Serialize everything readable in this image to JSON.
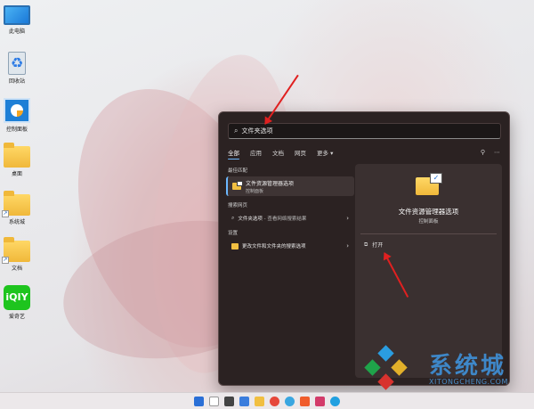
{
  "desktop": {
    "icons": [
      {
        "name": "此电脑",
        "glyph": "monitor-icon"
      },
      {
        "name": "回收站",
        "glyph": "recycle-bin-icon"
      },
      {
        "name": "控制面板",
        "glyph": "control-panel-icon"
      },
      {
        "name": "桌面",
        "glyph": "folder-icon"
      },
      {
        "name": "系统城",
        "glyph": "folder-shortcut-icon"
      },
      {
        "name": "文档",
        "glyph": "folder-shortcut-icon"
      },
      {
        "name": "爱奇艺",
        "glyph": "iqiyi-icon"
      }
    ],
    "iqiyi_logo": "iQIY"
  },
  "search": {
    "query": "文件夹选项",
    "tabs": [
      "全部",
      "应用",
      "文档",
      "网页",
      "更多 ▾"
    ],
    "active_tab": "全部",
    "sections": {
      "best_match": "最佳匹配",
      "web": "搜索网页",
      "settings": "设置"
    },
    "best_match": {
      "title": "文件资源管理器选项",
      "subtitle": "控制面板"
    },
    "web_result": {
      "term": "文件夹选项",
      "suffix": " - 查看网络搜索结果"
    },
    "settings_result": "更改文件和文件夹的搜索选项",
    "detail": {
      "title": "文件资源管理器选项",
      "subtitle": "控制面板",
      "action": "打开"
    }
  },
  "watermark": {
    "brand": "系统城",
    "url": "XITONGCHENG.COM"
  },
  "colors": {
    "accent": "#6cb8ff",
    "annotation": "#e02020",
    "brand_blue": "#3e87c8"
  }
}
